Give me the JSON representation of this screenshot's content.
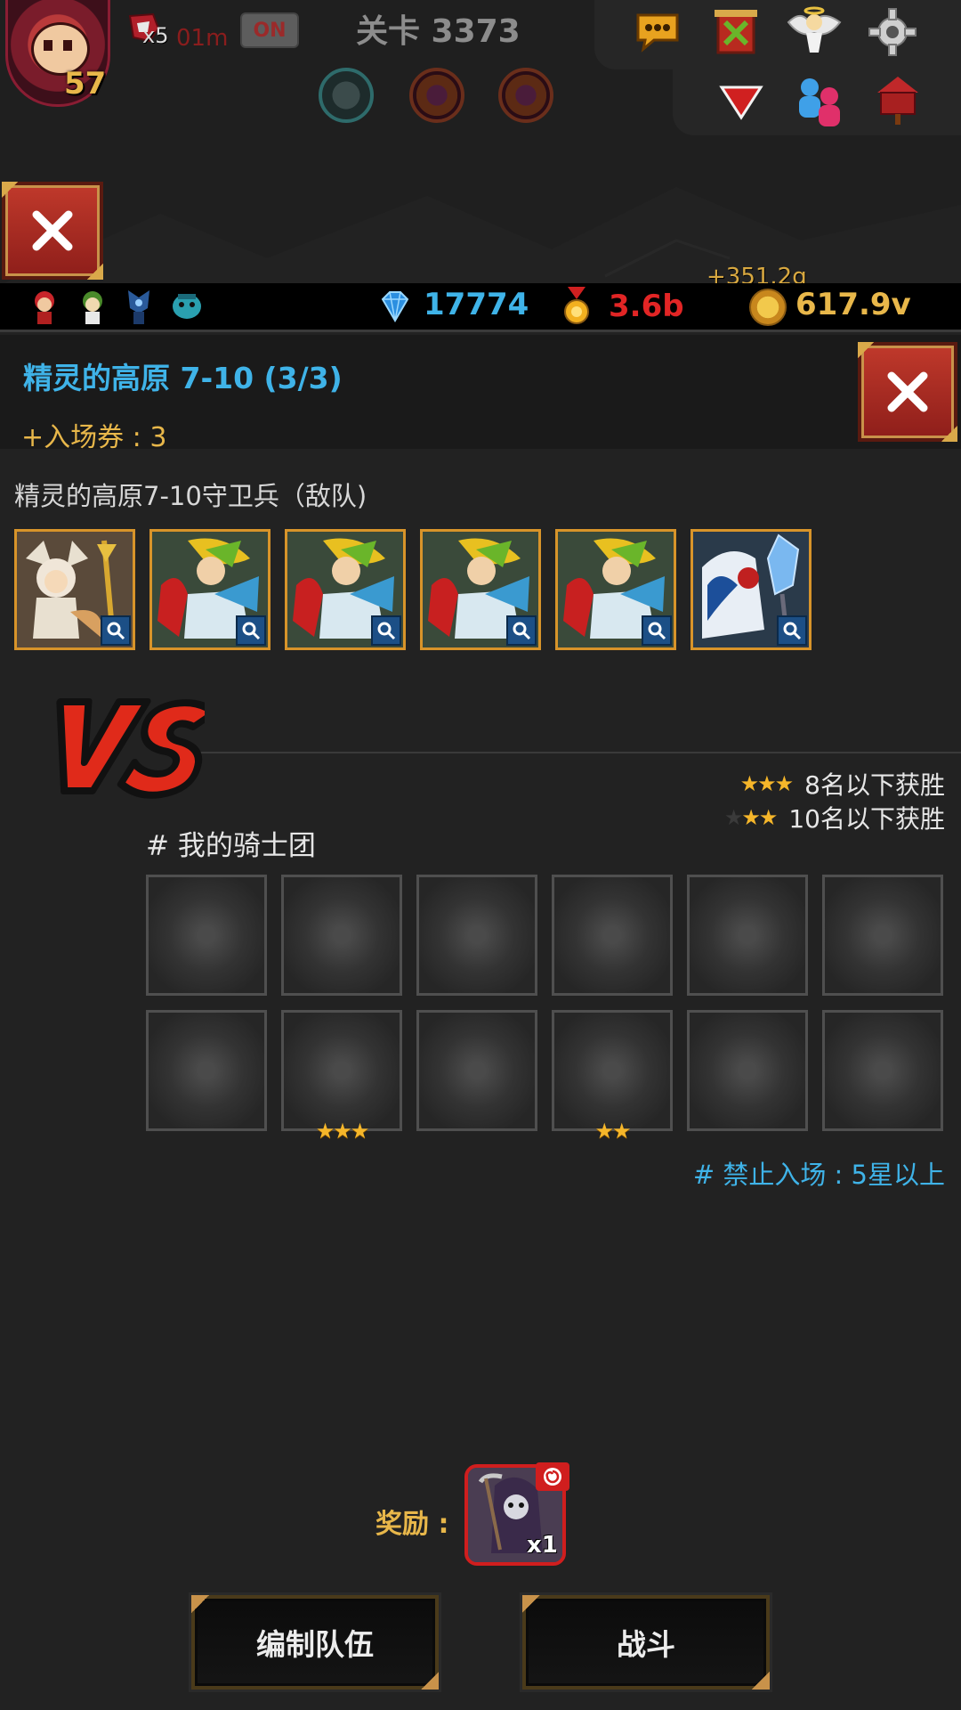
{
  "hud": {
    "player_level": "57",
    "boost_count": "x5",
    "boost_time": "01m",
    "auto_toggle": "ON",
    "stage_title": "关卡 3373"
  },
  "resources": {
    "gems": "17774",
    "medals": "3.6b",
    "gold": "617.9v",
    "gold_gain": "+351.2g"
  },
  "stage": {
    "name": "精灵的高原 7-10  (3/3)",
    "ticket": "+入场券 : 3",
    "enemy_label": "精灵的高原7-10守卫兵（敌队)",
    "enemies": [
      {
        "name": "fox-priestess"
      },
      {
        "name": "elf-archer"
      },
      {
        "name": "elf-archer"
      },
      {
        "name": "elf-archer"
      },
      {
        "name": "elf-archer"
      },
      {
        "name": "ice-beast"
      }
    ]
  },
  "conditions": {
    "three_star": "8名以下获胜",
    "two_star": "10名以下获胜"
  },
  "my_team": {
    "label": "# 我的骑士团",
    "slots_row1": [
      "",
      "",
      "",
      "",
      "",
      ""
    ],
    "slots_row2": [
      "",
      "★★★",
      "",
      "★★",
      "",
      ""
    ]
  },
  "ban_rule": "# 禁止入场 : 5星以上",
  "reward": {
    "label": "奖励 :",
    "quantity": "x1"
  },
  "buttons": {
    "edit_team": "编制队伍",
    "fight": "战斗"
  },
  "colors": {
    "background": "#222222",
    "accent_blue": "#3fb3e8",
    "accent_gold": "#e8b74a",
    "accent_red": "#e22525",
    "card_border": "#d8942a"
  }
}
